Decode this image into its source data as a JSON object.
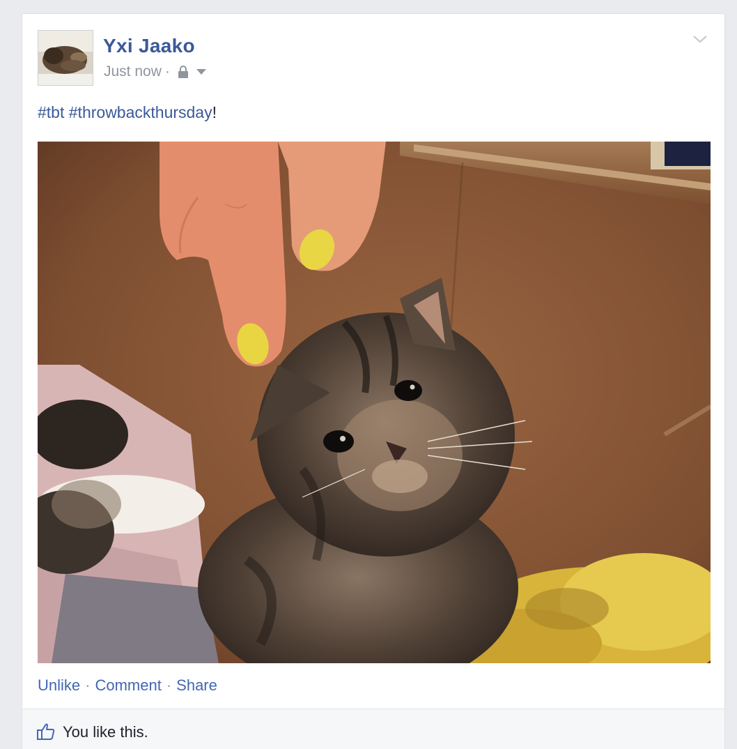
{
  "post": {
    "author_name": "Yxi Jaako",
    "timestamp": "Just now",
    "meta_separator": "·",
    "privacy_icon": "lock-icon",
    "audience_dropdown_icon": "triangle-down-icon",
    "options_icon": "chevron-down-icon",
    "text_parts": [
      {
        "type": "hashtag",
        "text": "#tbt"
      },
      {
        "type": "text",
        "text": " "
      },
      {
        "type": "hashtag",
        "text": "#throwbackthursday"
      },
      {
        "type": "text",
        "text": "!"
      }
    ],
    "actions": {
      "unlike_label": "Unlike",
      "comment_label": "Comment",
      "share_label": "Share",
      "separator": "·"
    },
    "likes": {
      "icon": "thumbs-up-icon",
      "text": "You like this."
    }
  },
  "colors": {
    "link_blue": "#3b5998",
    "action_blue": "#4267b2",
    "meta_gray": "#90949c",
    "page_bg": "#e9ebee",
    "likes_bg": "#f6f7f9"
  }
}
